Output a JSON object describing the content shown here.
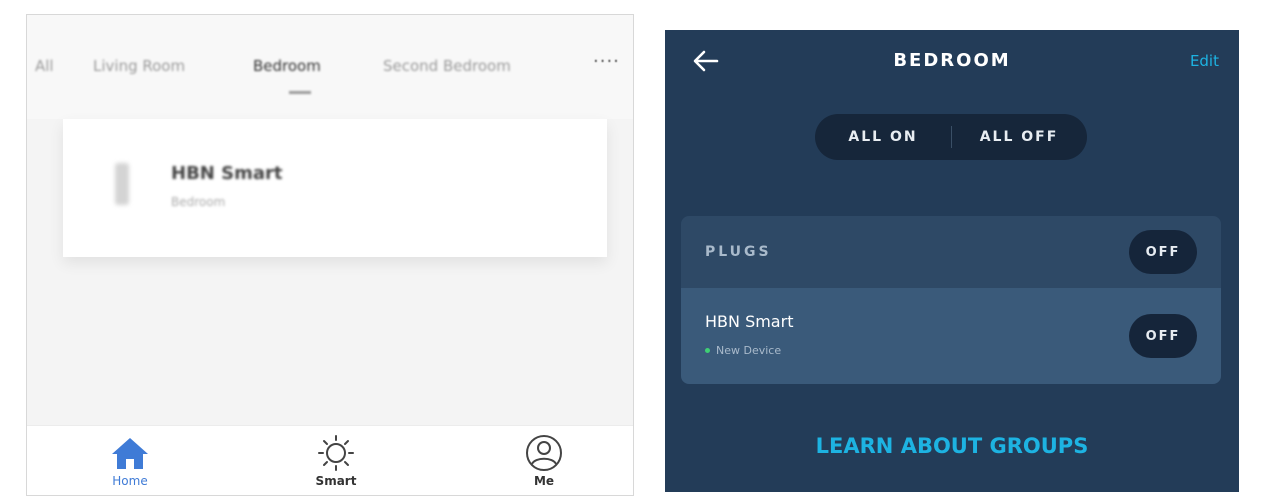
{
  "left_app": {
    "room_tabs": [
      {
        "label": "All"
      },
      {
        "label": "Living Room"
      },
      {
        "label": "Bedroom",
        "active": true
      },
      {
        "label": "Second Bedroom"
      }
    ],
    "more_tabs": "····",
    "device": {
      "name": "HBN Smart",
      "status": "Bedroom"
    },
    "nav": {
      "home": "Home",
      "smart": "Smart",
      "me": "Me"
    },
    "colors": {
      "accent": "#3f7bd6"
    }
  },
  "right_app": {
    "title": "BEDROOM",
    "edit": "Edit",
    "all_on": "ALL ON",
    "all_off": "ALL OFF",
    "group": {
      "title": "PLUGS",
      "state": "OFF",
      "devices": [
        {
          "name": "HBN Smart",
          "status": "New Device",
          "state": "OFF"
        }
      ]
    },
    "learn_link": "LEARN ABOUT GROUPS",
    "colors": {
      "background": "#233c58",
      "link": "#1db3e2",
      "status_dot": "#3fcf74"
    }
  }
}
